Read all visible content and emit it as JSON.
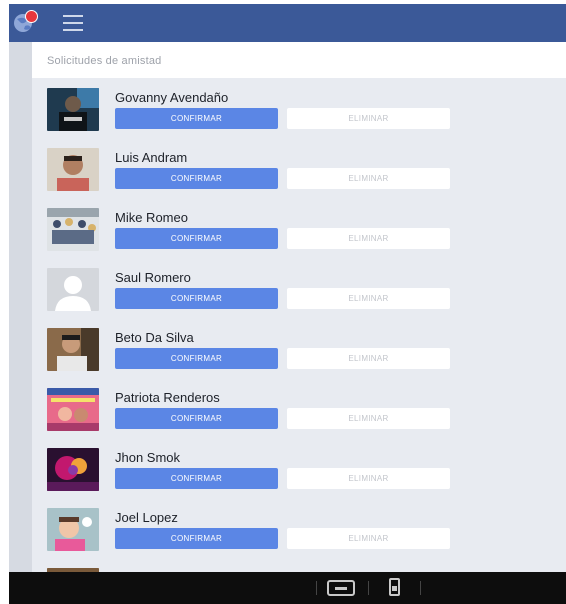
{
  "header": {
    "title": "Solicitudes de amistad"
  },
  "labels": {
    "confirm": "CONFIRMAR",
    "delete": "ELIMINAR"
  },
  "requests": [
    {
      "name": "Govanny Avendaño",
      "avatar_kind": "photo-dark"
    },
    {
      "name": "Luis Andram",
      "avatar_kind": "photo-face"
    },
    {
      "name": "Mike Romeo",
      "avatar_kind": "photo-group"
    },
    {
      "name": "Saul Romero",
      "avatar_kind": "silhouette"
    },
    {
      "name": "Beto Da Silva",
      "avatar_kind": "photo-face"
    },
    {
      "name": "Patriota Renderos",
      "avatar_kind": "photo-colorful"
    },
    {
      "name": "Jhon Smok",
      "avatar_kind": "photo-neon"
    },
    {
      "name": "Joel Lopez",
      "avatar_kind": "photo-child"
    }
  ],
  "colors": {
    "topbar": "#3b5998",
    "confirm_button": "#5b86e5",
    "badge": "#e8373c"
  }
}
